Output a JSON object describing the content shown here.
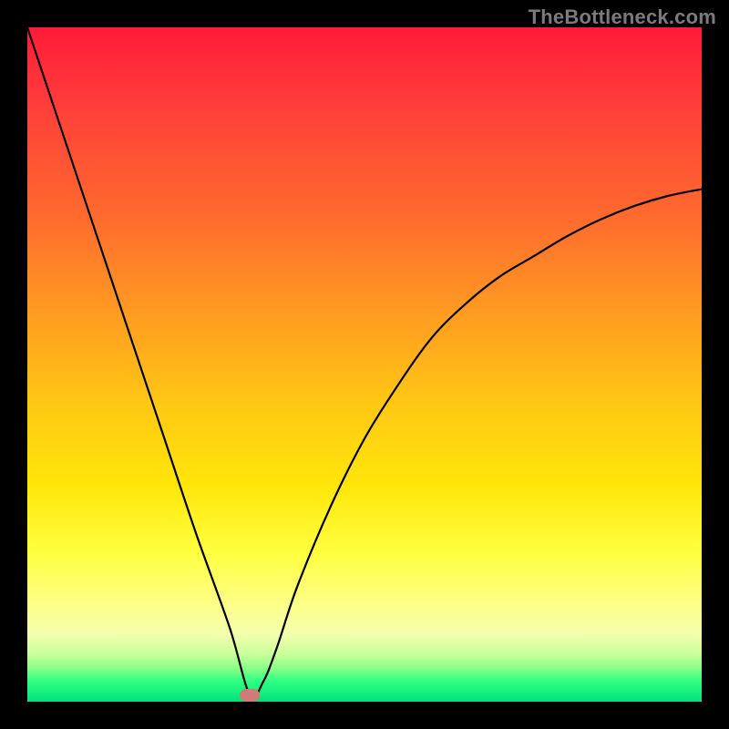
{
  "watermark": "TheBottleneck.com",
  "chart_data": {
    "type": "line",
    "title": "",
    "xlabel": "",
    "ylabel": "",
    "xlim": [
      0,
      100
    ],
    "ylim": [
      0,
      100
    ],
    "grid": false,
    "legend": false,
    "series": [
      {
        "name": "bottleneck-curve",
        "x": [
          0,
          5,
          10,
          15,
          20,
          25,
          30,
          33,
          35,
          37,
          40,
          45,
          50,
          55,
          60,
          65,
          70,
          75,
          80,
          85,
          90,
          95,
          100
        ],
        "values": [
          100,
          85,
          70,
          55,
          40,
          25,
          11,
          1,
          3,
          8,
          17,
          29,
          39,
          47,
          54,
          59,
          63,
          66,
          69,
          71.5,
          73.5,
          75,
          76
        ]
      }
    ],
    "marker": {
      "x": 33,
      "y": 1
    },
    "background_bands": [
      {
        "name": "red",
        "from": 100,
        "to": 68
      },
      {
        "name": "orange",
        "from": 68,
        "to": 44
      },
      {
        "name": "yellow",
        "from": 44,
        "to": 14
      },
      {
        "name": "pale",
        "from": 14,
        "to": 5
      },
      {
        "name": "green",
        "from": 5,
        "to": 0
      }
    ]
  },
  "colors": {
    "curve": "#000000",
    "marker": "#cf7b76",
    "frame": "#000000"
  }
}
